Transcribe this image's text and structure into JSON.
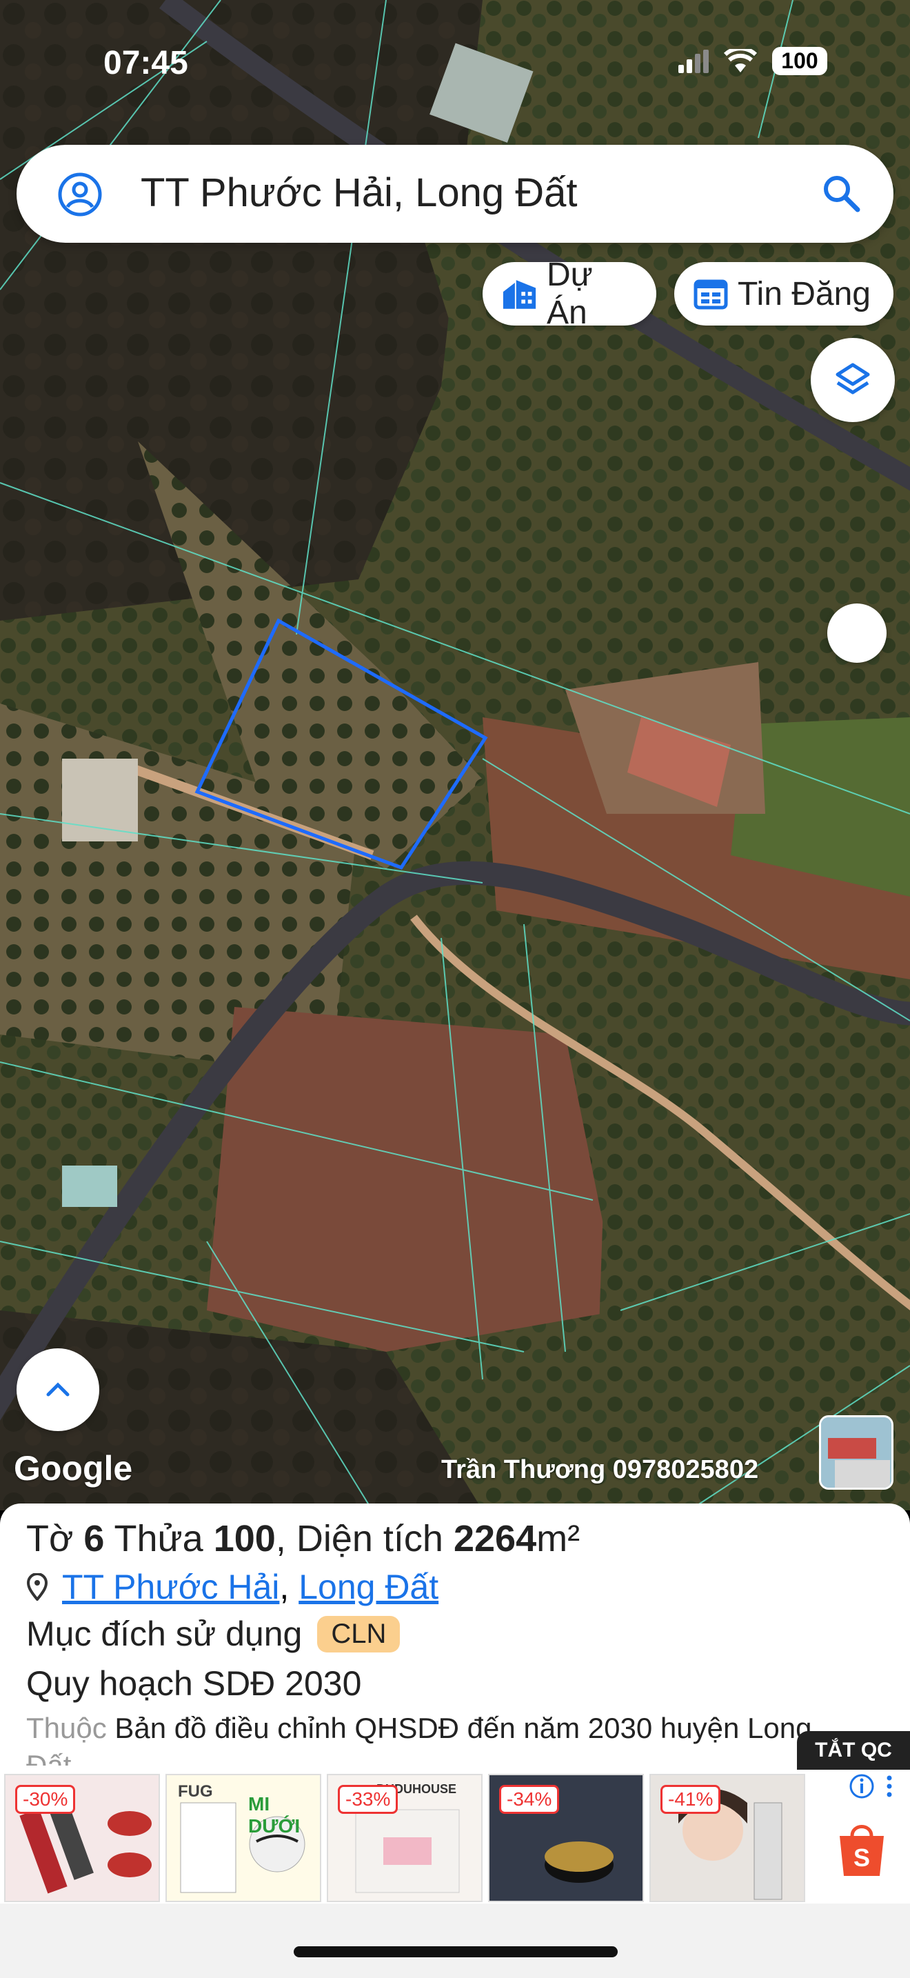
{
  "status_bar": {
    "time": "07:45",
    "battery": "100"
  },
  "search": {
    "text": "TT Phước Hải, Long Đất"
  },
  "buttons": {
    "projects": "Dự Án",
    "listings": "Tin Đăng"
  },
  "map": {
    "brand": "Google",
    "credit": "Trần Thương 0978025802"
  },
  "parcel": {
    "sheet_label": "Tờ",
    "sheet_no": "6",
    "lot_label": "Thửa",
    "lot_no": "100",
    "area_label": "Diện tích",
    "area_value": "2264",
    "area_unit": "m²",
    "ward": "TT Phước Hải",
    "district": "Long Đất",
    "purpose_label": "Mục đích sử dụng",
    "purpose_code": "CLN",
    "plan_label": "Quy hoạch SDĐ 2030",
    "belongs_prefix": "Thuộc",
    "belongs_text": "Bản đồ điều chỉnh QHSDĐ đến năm 2030 huyện Long",
    "belongs_text_cont": "Đất"
  },
  "ads": {
    "close_label": "TẮT QC",
    "items": [
      {
        "discount": "-30%"
      },
      {
        "discount": "",
        "label": "MI DƯỚI",
        "brand": "FUG"
      },
      {
        "discount": "-33%",
        "brand": "DUDUHOUSE"
      },
      {
        "discount": "-34%"
      },
      {
        "discount": "-41%"
      }
    ]
  },
  "colors": {
    "accent": "#1a73e8",
    "parcel_outline": "#1e6bff",
    "boundary": "#5fe0c8",
    "badge": "#fbcf8e"
  }
}
